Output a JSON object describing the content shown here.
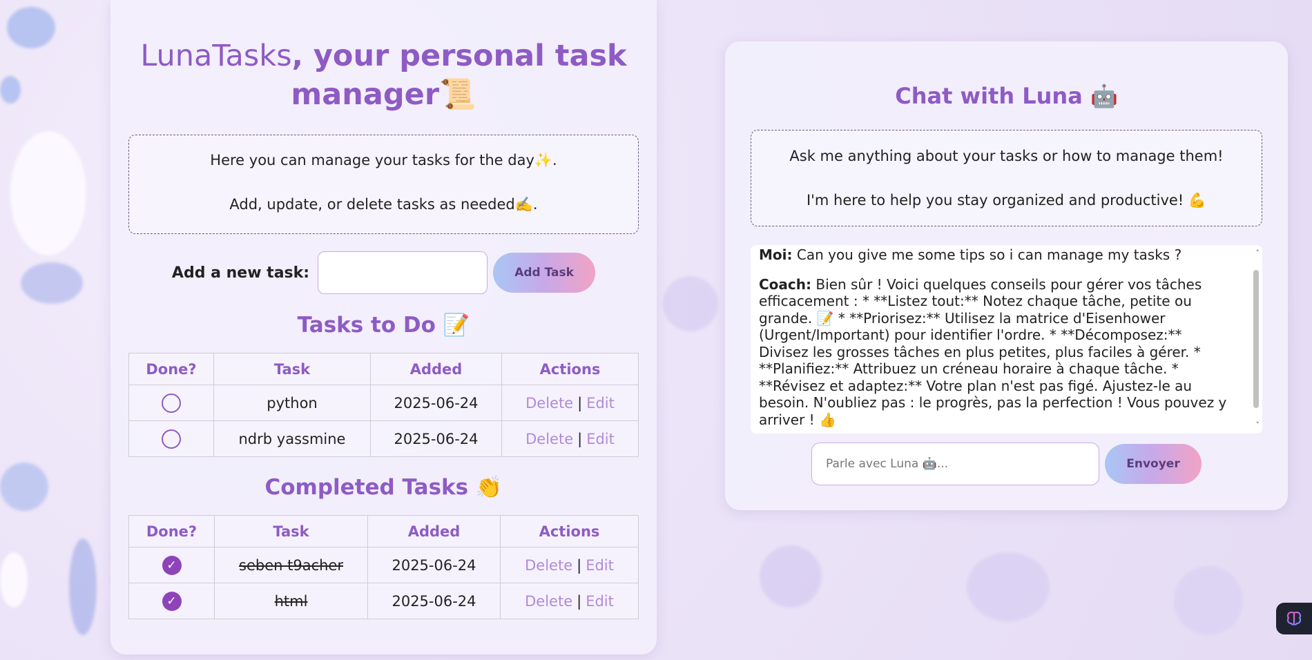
{
  "header": {
    "title_brand": "LunaTasks",
    "title_rest": ", your personal task manager",
    "title_icon": "📜"
  },
  "intro": {
    "line1": "Here you can manage your tasks for the day✨.",
    "line2": "Add, update, or delete tasks as needed✍️."
  },
  "add_task": {
    "label": "Add a new task:",
    "input_value": "",
    "button_label": "Add Task"
  },
  "todo": {
    "heading": "Tasks to Do 📝",
    "columns": [
      "Done?",
      "Task",
      "Added",
      "Actions"
    ],
    "rows": [
      {
        "task": "python",
        "added": "2025-06-24",
        "delete": "Delete",
        "edit": "Edit",
        "done": false
      },
      {
        "task": "ndrb yassmine",
        "added": "2025-06-24",
        "delete": "Delete",
        "edit": "Edit",
        "done": false
      }
    ]
  },
  "completed": {
    "heading": "Completed Tasks 👏",
    "columns": [
      "Done?",
      "Task",
      "Added",
      "Actions"
    ],
    "rows": [
      {
        "task": "seben t9acher",
        "added": "2025-06-24",
        "delete": "Delete",
        "edit": "Edit",
        "done": true
      },
      {
        "task": "html",
        "added": "2025-06-24",
        "delete": "Delete",
        "edit": "Edit",
        "done": true
      }
    ]
  },
  "chat": {
    "title": "Chat with Luna 🤖",
    "intro_line1": "Ask me anything about your tasks or how to manage them!",
    "intro_line2": "I'm here to help you stay organized and productive! 💪",
    "messages": [
      {
        "speaker": "Moi:",
        "text": "Can you give me some tips so i can manage my tasks ?"
      },
      {
        "speaker": "Coach:",
        "text": "Bien sûr ! Voici quelques conseils pour gérer vos tâches efficacement : * **Listez tout:** Notez chaque tâche, petite ou grande. 📝 * **Priorisez:** Utilisez la matrice d'Eisenhower (Urgent/Important) pour identifier l'ordre. * **Décomposez:** Divisez les grosses tâches en plus petites, plus faciles à gérer. * **Planifiez:** Attribuez un créneau horaire à chaque tâche. * **Révisez et adaptez:** Votre plan n'est pas figé. Ajustez-le au besoin. N'oubliez pas : le progrès, pas la perfection ! Vous pouvez y arriver ! 👍"
      }
    ],
    "input_placeholder": "Parle avec Luna 🤖...",
    "send_label": "Envoyer"
  },
  "colors": {
    "accent": "#8e5bc4",
    "link": "#b08ad8",
    "checkbox_fill": "#8e44b8"
  },
  "icons": {
    "check": "✓",
    "scroll_up": "˄",
    "scroll_down": "˅",
    "corner_widget": "brain-icon"
  }
}
